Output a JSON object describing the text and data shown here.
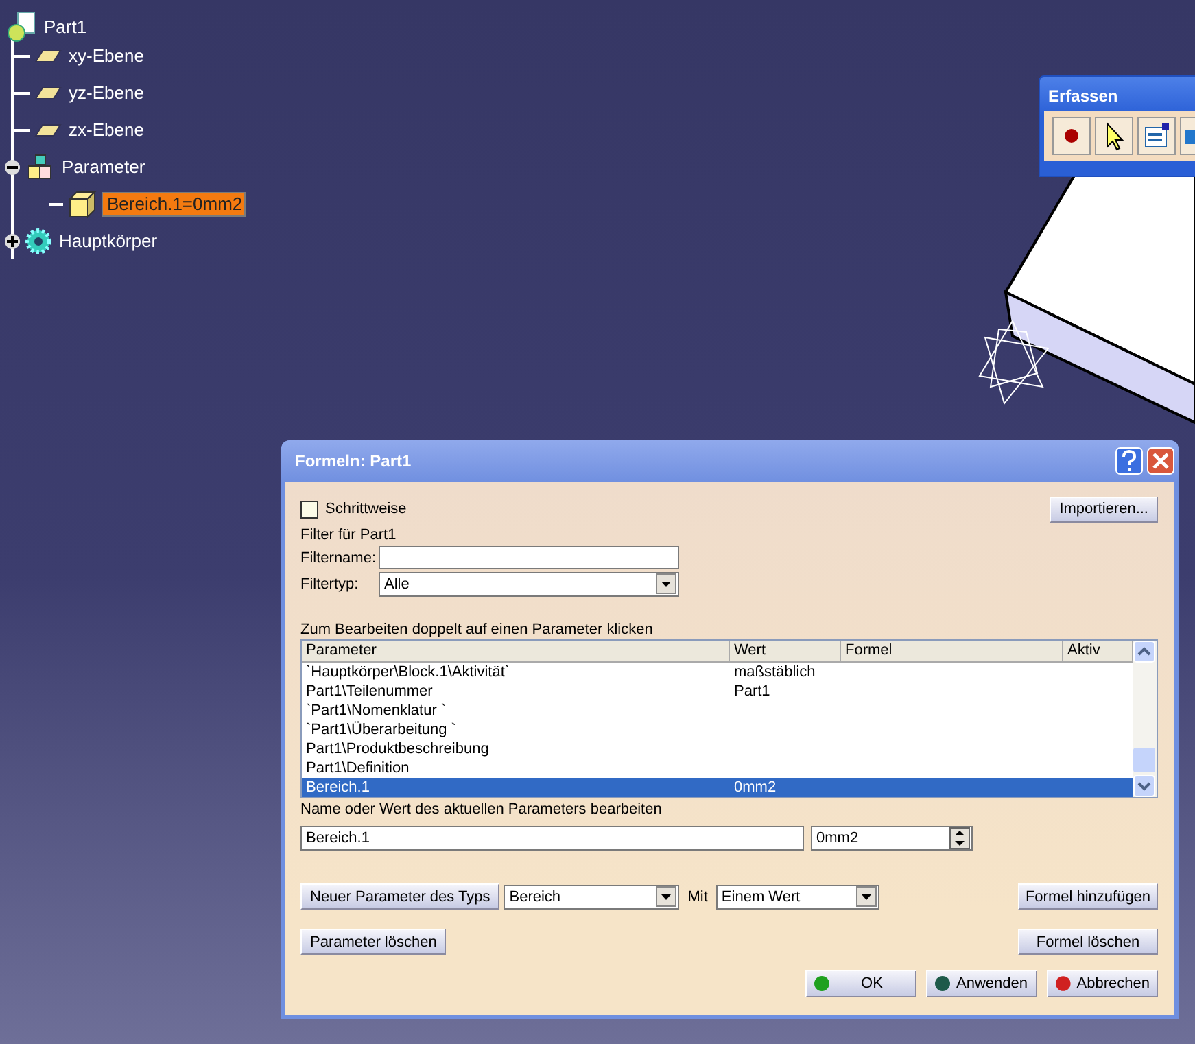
{
  "tree": {
    "label": "Part1",
    "children": [
      {
        "label": "xy-Ebene",
        "kind": "plane"
      },
      {
        "label": "yz-Ebene",
        "kind": "plane"
      },
      {
        "label": "zx-Ebene",
        "kind": "plane"
      },
      {
        "label": "Parameter",
        "kind": "parameters",
        "expanded": true,
        "children": [
          {
            "label": "Bereich.1=0mm2",
            "kind": "parameter",
            "selected": true
          }
        ]
      },
      {
        "label": "Hauptkörper",
        "kind": "body",
        "expanded": false
      }
    ]
  },
  "toolbar": {
    "title": "Erfassen"
  },
  "dialog": {
    "title": "Formeln: Part1",
    "stepwise": {
      "label": "Schrittweise",
      "checked": false
    },
    "import_button": "Importieren...",
    "filter_caption": "Filter für Part1",
    "filtername": {
      "label": "Filtername:"
    },
    "filtertyp": {
      "label": "Filtertyp:",
      "value": "Alle"
    },
    "list_caption": "Zum Bearbeiten doppelt auf einen Parameter klicken",
    "columns": [
      "Parameter",
      "Wert",
      "Formel",
      "Aktiv"
    ],
    "rows": [
      {
        "parameter": "`Hauptkörper\\Block.1\\Aktivität`",
        "wert": "maßstäblich",
        "selected": false
      },
      {
        "parameter": "Part1\\Teilenummer",
        "wert": "Part1",
        "selected": false
      },
      {
        "parameter": "`Part1\\Nomenklatur `",
        "selected": false
      },
      {
        "parameter": "`Part1\\Überarbeitung `",
        "selected": false
      },
      {
        "parameter": "Part1\\Produktbeschreibung",
        "selected": false
      },
      {
        "parameter": "Part1\\Definition",
        "selected": false
      },
      {
        "parameter": "Bereich.1",
        "wert": "0mm2",
        "selected": true
      }
    ],
    "edit_caption": "Name oder Wert des aktuellen Parameters bearbeiten",
    "name_value": "Bereich.1",
    "value_value": "0mm2",
    "new_param_button": "Neuer Parameter des Typs",
    "type_select": "Bereich",
    "mit_label": "Mit",
    "mit_select": "Einem Wert",
    "add_formula_button": "Formel hinzufügen",
    "delete_param_button": "Parameter löschen",
    "delete_formula_button": "Formel löschen",
    "actions": [
      {
        "label": "OK",
        "color": "#1fa01f"
      },
      {
        "label": "Anwenden",
        "color": "#1e5a4a"
      },
      {
        "label": "Abbrechen",
        "color": "#d02020"
      }
    ]
  }
}
